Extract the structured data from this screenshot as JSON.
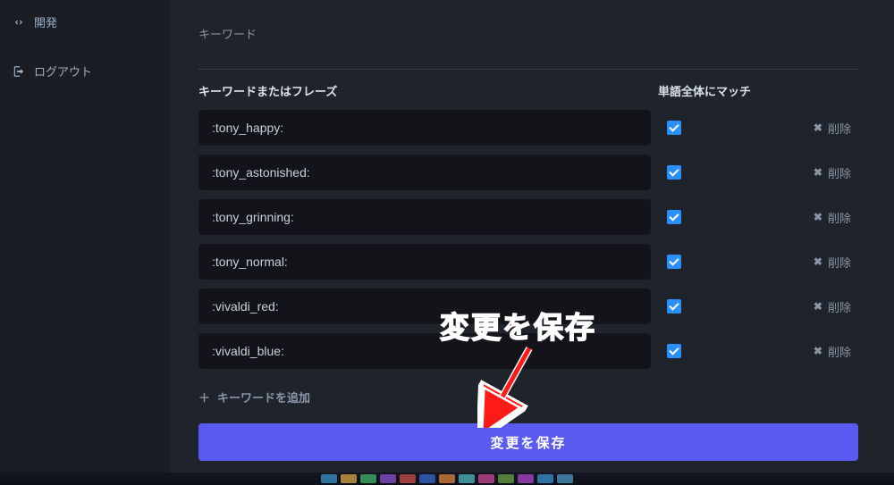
{
  "sidebar": {
    "items": [
      {
        "label": "開発",
        "icon": "code-icon"
      },
      {
        "label": "ログアウト",
        "icon": "logout-icon"
      }
    ]
  },
  "main": {
    "section_title": "キーワード",
    "columns": {
      "keyword": "キーワードまたはフレーズ",
      "whole_word": "単語全体にマッチ"
    },
    "rows": [
      {
        "value": ":tony_happy:",
        "whole_word": true,
        "delete_label": "削除"
      },
      {
        "value": ":tony_astonished:",
        "whole_word": true,
        "delete_label": "削除"
      },
      {
        "value": ":tony_grinning:",
        "whole_word": true,
        "delete_label": "削除"
      },
      {
        "value": ":tony_normal:",
        "whole_word": true,
        "delete_label": "削除"
      },
      {
        "value": ":vivaldi_red:",
        "whole_word": true,
        "delete_label": "削除"
      },
      {
        "value": ":vivaldi_blue:",
        "whole_word": true,
        "delete_label": "削除"
      }
    ],
    "add_label": "キーワードを追加",
    "save_label": "変更を保存"
  },
  "annotation": {
    "text": "変更を保存"
  },
  "taskbar_colors": [
    "#3a9bd8",
    "#e9b24a",
    "#45c06e",
    "#9156d8",
    "#d9534f",
    "#3a6fd8",
    "#ea8c3a",
    "#4fc4cf",
    "#d94aa0",
    "#6fae45",
    "#b84ad9",
    "#3a9bd8",
    "#4fa0cf"
  ]
}
